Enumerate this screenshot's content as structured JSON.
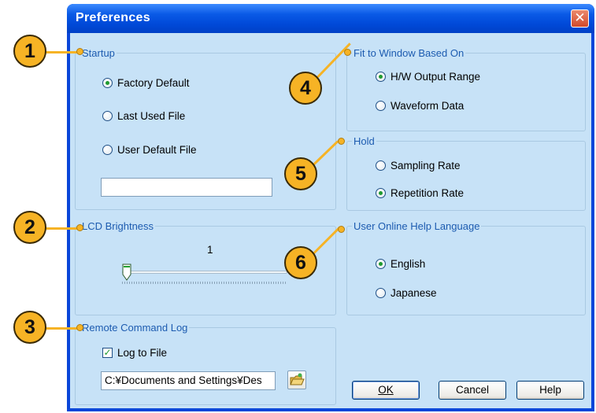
{
  "window": {
    "title": "Preferences",
    "close_glyph": "✕"
  },
  "startup": {
    "legend": "Startup",
    "options": [
      "Factory Default",
      "Last Used File",
      "User Default File"
    ],
    "selected": "Factory Default",
    "file_value": ""
  },
  "fit_to_window": {
    "legend": "Fit to Window Based On",
    "options": [
      "H/W Output Range",
      "Waveform Data"
    ],
    "selected": "H/W Output Range"
  },
  "hold": {
    "legend": "Hold",
    "options": [
      "Sampling Rate",
      "Repetition Rate"
    ],
    "selected": "Repetition Rate"
  },
  "lcd_brightness": {
    "legend": "LCD Brightness",
    "value": "1"
  },
  "help_language": {
    "legend": "User Online Help Language",
    "options": [
      "English",
      "Japanese"
    ],
    "selected": "English"
  },
  "remote_log": {
    "legend": "Remote Command Log",
    "log_to_file_label": "Log to File",
    "log_to_file_checked": true,
    "path_value": "C:¥Documents and Settings¥Des",
    "browse_icon": "folder-browse-icon"
  },
  "buttons": {
    "ok": "OK",
    "cancel": "Cancel",
    "help": "Help"
  },
  "callouts": [
    "1",
    "2",
    "3",
    "4",
    "5",
    "6"
  ],
  "colors": {
    "callout_fill": "#f6b325",
    "title_bar": "#0a5ae6",
    "client_bg": "#c7e2f7",
    "legend_text": "#1c5bb0"
  }
}
